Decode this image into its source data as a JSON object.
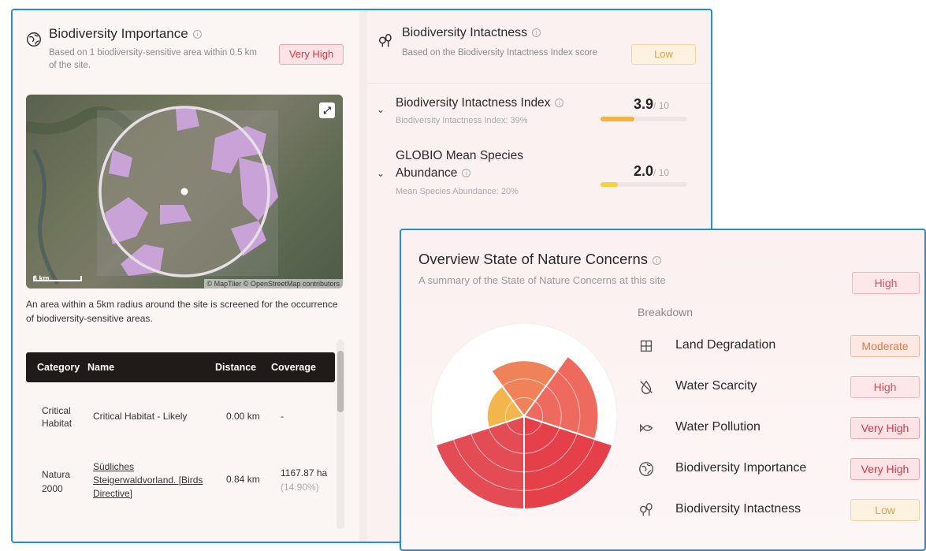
{
  "importance": {
    "title": "Biodiversity Importance",
    "subtitle": "Based on 1 biodiversity-sensitive area within 0.5 km of the site.",
    "badge": "Very High",
    "map_attribution": "© MapTiler © OpenStreetMap contributors",
    "map_scale": "3 km",
    "description": "An area within a 5km radius around the site is screened for the occurrence of biodiversity-sensitive areas.",
    "table": {
      "headers": [
        "Category",
        "Name",
        "Distance",
        "Coverage"
      ],
      "rows": [
        {
          "category": "Critical Habitat",
          "name": "Critical Habitat - Likely",
          "distance": "0.00 km",
          "coverage": "-",
          "coverage_pct": ""
        },
        {
          "category": "Natura 2000",
          "name": "Südliches Steigerwaldvorland. [Birds Directive]",
          "distance": "0.84 km",
          "coverage": "1167.87 ha",
          "coverage_pct": "(14.90%)"
        }
      ]
    }
  },
  "intactness": {
    "title": "Biodiversity Intactness",
    "subtitle": "Based on the Biodiversity Intactness Index score",
    "badge": "Low",
    "metrics": [
      {
        "title": "Biodiversity Intactness Index",
        "sub": "Biodiversity Intactness Index: 39%",
        "score": "3.9",
        "denominator": "/ 10",
        "fill": 0.39,
        "color": "#f2b43e"
      },
      {
        "title": "GLOBIO Mean Species Abundance",
        "sub": "Mean Species Abundance: 20%",
        "score": "2.0",
        "denominator": "/ 10",
        "fill": 0.2,
        "color": "#f5d13e"
      }
    ]
  },
  "overview": {
    "title": "Overview State of Nature Concerns",
    "subtitle": "A summary of the State of Nature Concerns at this site",
    "badge": "High",
    "breakdown_label": "Breakdown",
    "items": [
      {
        "label": "Land Degradation",
        "level": "Moderate",
        "icon": "grid-icon"
      },
      {
        "label": "Water Scarcity",
        "level": "High",
        "icon": "no-water-drop-icon"
      },
      {
        "label": "Water Pollution",
        "level": "Very High",
        "icon": "fish-icon"
      },
      {
        "label": "Biodiversity Importance",
        "level": "Very High",
        "icon": "leaf-globe-icon"
      },
      {
        "label": "Biodiversity Intactness",
        "level": "Low",
        "icon": "trees-icon"
      }
    ],
    "rose": [
      {
        "name": "Land Degradation",
        "level": 3,
        "color": "#f0825a"
      },
      {
        "name": "Water Scarcity",
        "level": 4,
        "color": "#ef6a5e"
      },
      {
        "name": "Water Pollution",
        "level": 5,
        "color": "#e53f4a"
      },
      {
        "name": "Biodiversity Importance",
        "level": 5,
        "color": "#e34b55"
      },
      {
        "name": "Biodiversity Intactness",
        "level": 2,
        "color": "#f3b64d"
      }
    ],
    "rose_max": 5
  },
  "colors": {
    "accent_border": "#1f8fd6",
    "very_high": "#d33a45",
    "low": "#e0a24b"
  }
}
